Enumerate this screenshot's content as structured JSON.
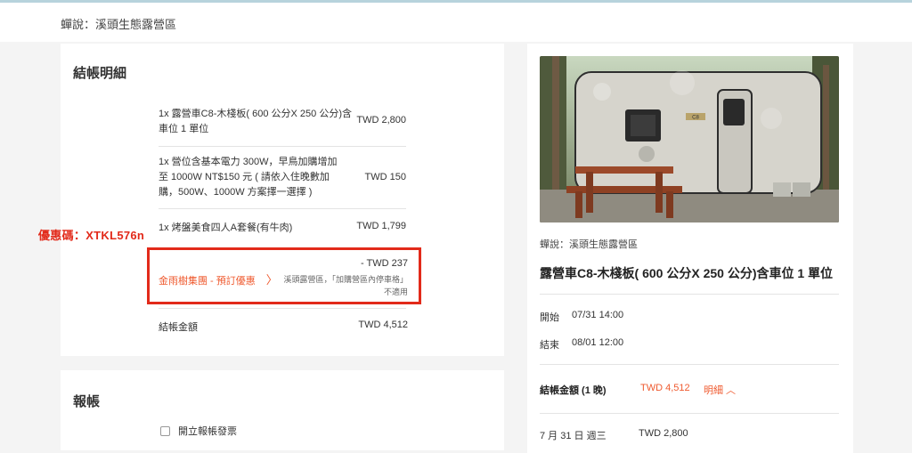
{
  "header": {
    "breadcrumb": "蟬說：溪頭生態露營區"
  },
  "checkout": {
    "title": "結帳明細",
    "items": [
      {
        "description": "1x 露營車C8-木棧板( 600 公分X 250 公分)含車位 1 單位",
        "price": "TWD 2,800"
      },
      {
        "description": "1x 營位含基本電力 300W，早鳥加購增加至 1000W NT$150 元 ( 請依入住晚數加購，500W、1000W 方案擇一選擇 )",
        "price": "TWD 150"
      },
      {
        "description": "1x 烤盤美食四人A套餐(有牛肉)",
        "price": "TWD 1,799"
      }
    ],
    "discount": {
      "label": "金雨樹集團 - 預訂優惠",
      "chevron": "〉",
      "amount": "- TWD 237",
      "note_line1": "溪頭露營區，「加購營區內停車格」",
      "note_line2": "不適用"
    },
    "total_label": "結帳金額",
    "total_value": "TWD 4,512"
  },
  "coupon_annotation": "優惠碼：XTKL576n",
  "report": {
    "title": "報帳",
    "checkbox_label": "開立報帳發票"
  },
  "summary": {
    "breadcrumb": "蟬說：溪頭生態露營區",
    "title": "露營車C8-木棧板( 600 公分X 250 公分)含車位 1 單位",
    "start_label": "開始",
    "start_value": "07/31 14:00",
    "end_label": "結束",
    "end_value": "08/01 12:00",
    "total_label": "結帳金額 (1 晚)",
    "total_value": "TWD 4,512",
    "detail_link": "明細 ︿",
    "date_row_label": "7 月 31 日 週三",
    "date_row_value": "TWD 2,800",
    "photo_sign": "C8"
  },
  "colors": {
    "accent": "#ef5a2f",
    "annotation_red": "#e22a1a",
    "background": "#f4f4f4"
  }
}
